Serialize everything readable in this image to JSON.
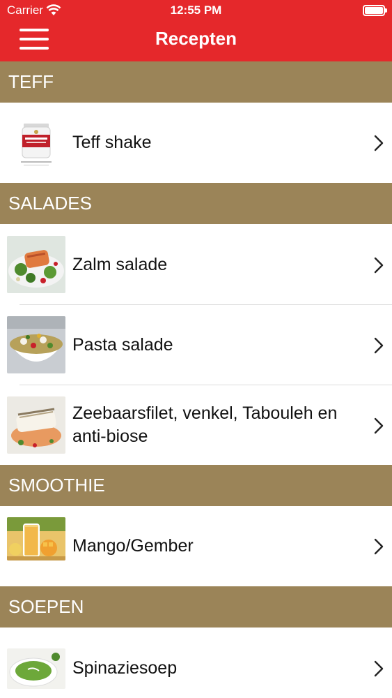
{
  "status_bar": {
    "carrier": "Carrier",
    "time": "12:55 PM"
  },
  "nav": {
    "title": "Recepten",
    "menu_icon": "hamburger-menu-icon"
  },
  "colors": {
    "navbar": "#e5282b",
    "section_header": "#9b8458"
  },
  "sections": [
    {
      "title": "TEFF",
      "items": [
        {
          "label": "Teff shake",
          "thumb": "shake-jar-image"
        }
      ]
    },
    {
      "title": "SALADES",
      "items": [
        {
          "label": "Zalm salade",
          "thumb": "salmon-salad-image"
        },
        {
          "label": "Pasta salade",
          "thumb": "pasta-salad-image"
        },
        {
          "label": "Zeebaarsfilet, venkel, Tabouleh en anti-biose",
          "thumb": "sea-bass-image"
        }
      ]
    },
    {
      "title": "SMOOTHIE",
      "items": [
        {
          "label": "Mango/Gember",
          "thumb": "mango-smoothie-image"
        }
      ]
    },
    {
      "title": "SOEPEN",
      "items": [
        {
          "label": "Spinaziesoep",
          "thumb": "spinach-soup-image"
        }
      ]
    }
  ]
}
